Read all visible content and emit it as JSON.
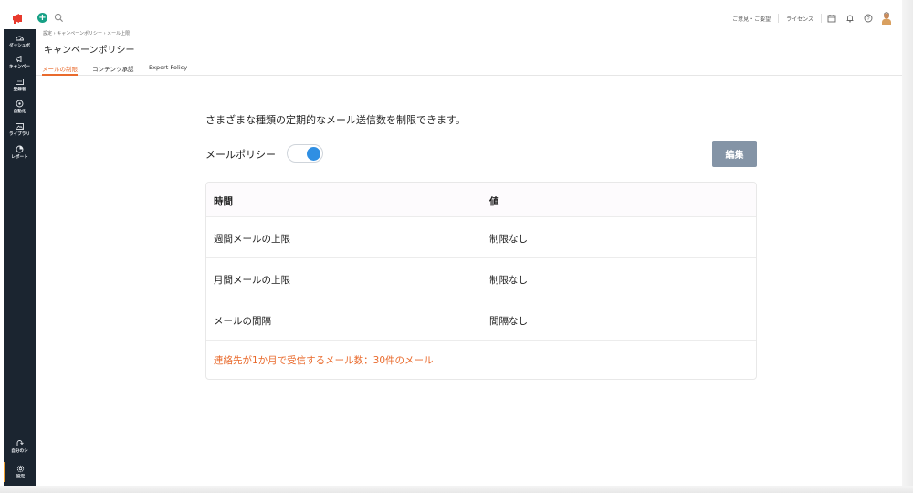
{
  "topbar": {
    "links": [
      "ご意見・ご要望",
      "ライセンス"
    ]
  },
  "sidebar": {
    "items": [
      {
        "label": "ダッシュボ",
        "icon": "dashboard-icon"
      },
      {
        "label": "キャンペー",
        "icon": "megaphone-icon"
      },
      {
        "label": "登録者",
        "icon": "contacts-icon"
      },
      {
        "label": "自動化",
        "icon": "automation-icon"
      },
      {
        "label": "ライブラリ",
        "icon": "library-icon"
      },
      {
        "label": "レポート",
        "icon": "reports-icon"
      }
    ],
    "bottom_items": [
      {
        "label": "自分のシ",
        "icon": "refer-icon"
      },
      {
        "label": "設定",
        "icon": "gear-icon"
      }
    ]
  },
  "breadcrumb": [
    "設定",
    "キャンペーンポリシー",
    "メール上限"
  ],
  "page": {
    "title": "キャンペーンポリシー",
    "tabs": [
      "メールの制限",
      "コンテンツ承認",
      "Export Policy"
    ],
    "description": "さまざまな種類の定期的なメール送信数を制限できます。",
    "policy_label": "メールポリシー",
    "edit_label": "編集"
  },
  "table": {
    "headers": [
      "時間",
      "値"
    ],
    "rows": [
      [
        "週間メールの上限",
        "制限なし"
      ],
      [
        "月間メールの上限",
        "制限なし"
      ],
      [
        "メールの間隔",
        "間隔なし"
      ]
    ],
    "footnote": "連絡先が1か月で受信するメール数：30件のメール"
  },
  "colors": {
    "accent": "#e96a2c",
    "sidebar_bg": "#1b2530",
    "toggle_on": "#2f8fe3",
    "edit_button": "#8494a6"
  }
}
